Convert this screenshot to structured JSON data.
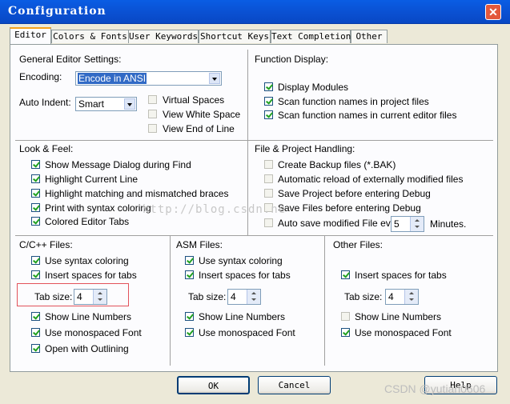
{
  "window": {
    "title": "Configuration",
    "close_glyph": "✕"
  },
  "tabs": [
    {
      "label": "Editor"
    },
    {
      "label": "Colors & Fonts"
    },
    {
      "label": "User Keywords"
    },
    {
      "label": "Shortcut Keys"
    },
    {
      "label": "Text Completion"
    },
    {
      "label": "Other"
    }
  ],
  "general": {
    "heading": "General Editor Settings:",
    "encoding_label": "Encoding:",
    "encoding_value": "Encode in ANSI",
    "auto_indent_label": "Auto Indent:",
    "auto_indent_value": "Smart",
    "virtual_spaces": "Virtual Spaces",
    "view_white_space": "View White Space",
    "view_end_of_line": "View End of Line"
  },
  "function_display": {
    "heading": "Function Display:",
    "display_modules": "Display Modules",
    "scan_project": "Scan function names in project files",
    "scan_current": "Scan function names in current editor files"
  },
  "look_feel": {
    "heading": "Look & Feel:",
    "items": [
      "Show Message Dialog during Find",
      "Highlight Current Line",
      "Highlight matching and mismatched braces",
      "Print with syntax coloring",
      "Colored Editor Tabs"
    ]
  },
  "file_handling": {
    "heading": "File & Project Handling:",
    "create_backup": "Create Backup files (*.BAK)",
    "auto_reload": "Automatic reload of externally modified files",
    "save_project": "Save Project before entering Debug",
    "save_files": "Save Files before entering Debug",
    "auto_save": "Auto save modified File every",
    "auto_save_minutes": "5",
    "minutes_label": "Minutes."
  },
  "c_files": {
    "heading": "C/C++ Files:",
    "use_syntax": "Use syntax coloring",
    "insert_spaces": "Insert spaces for tabs",
    "tab_size_label": "Tab size:",
    "tab_size": "4",
    "show_line_numbers": "Show Line Numbers",
    "monospaced": "Use monospaced Font",
    "outlining": "Open with Outlining"
  },
  "asm_files": {
    "heading": "ASM Files:",
    "use_syntax": "Use syntax coloring",
    "insert_spaces": "Insert spaces for tabs",
    "tab_size_label": "Tab size:",
    "tab_size": "4",
    "show_line_numbers": "Show Line Numbers",
    "monospaced": "Use monospaced Font"
  },
  "other_files": {
    "heading": "Other Files:",
    "insert_spaces": "Insert spaces for tabs",
    "tab_size_label": "Tab size:",
    "tab_size": "4",
    "show_line_numbers": "Show Line Numbers",
    "monospaced": "Use monospaced Font"
  },
  "buttons": {
    "ok": "OK",
    "cancel": "Cancel",
    "help": "Help"
  },
  "watermark": "http://blog.csdn.ne",
  "csdn_mark": "CSDN @yutian0606",
  "colors": {
    "title_bar": "#0a5de4",
    "close_button": "#e3583b",
    "highlight": "#316ac5",
    "tab_accent": "#f5a21b",
    "check": "#21a121",
    "annotation_box": "#e2525a"
  }
}
